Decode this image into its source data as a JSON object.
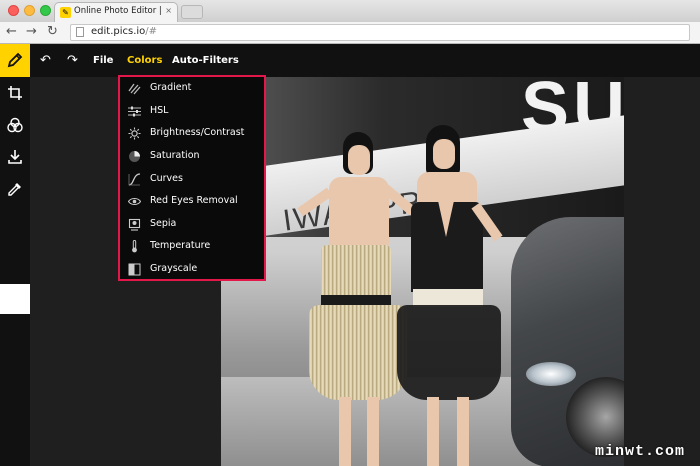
{
  "browser": {
    "tab_title": "Online Photo Editor | Edit...",
    "tab_close": "×",
    "back": "←",
    "forward": "→",
    "reload": "↻",
    "url_domain": "edit.pics.io",
    "url_path": "/#"
  },
  "app": {
    "menu": {
      "undo": "↶",
      "redo": "↷",
      "file": "File",
      "colors": "Colors",
      "auto_filters": "Auto-Filters"
    },
    "colors_menu": [
      {
        "label": "Gradient",
        "icon": "gradient-icon"
      },
      {
        "label": "HSL",
        "icon": "hsl-sliders-icon"
      },
      {
        "label": "Brightness/Contrast",
        "icon": "sun-icon"
      },
      {
        "label": "Saturation",
        "icon": "saturation-icon"
      },
      {
        "label": "Curves",
        "icon": "curves-icon"
      },
      {
        "label": "Red Eyes Removal",
        "icon": "eye-icon"
      },
      {
        "label": "Sepia",
        "icon": "sepia-icon"
      },
      {
        "label": "Temperature",
        "icon": "thermometer-icon"
      },
      {
        "label": "Grayscale",
        "icon": "grayscale-icon"
      }
    ],
    "sidebar_tools": [
      "pencil-icon",
      "crop-icon",
      "filters-icon",
      "download-icon",
      "eyedropper-icon"
    ]
  },
  "photo": {
    "sign_text": "IWAN PR",
    "logo_text": "SUC"
  },
  "watermark": "minwt.com",
  "colors": {
    "accent": "#ffd200",
    "menu_border": "#e3174a",
    "bar_bg": "#111111"
  }
}
